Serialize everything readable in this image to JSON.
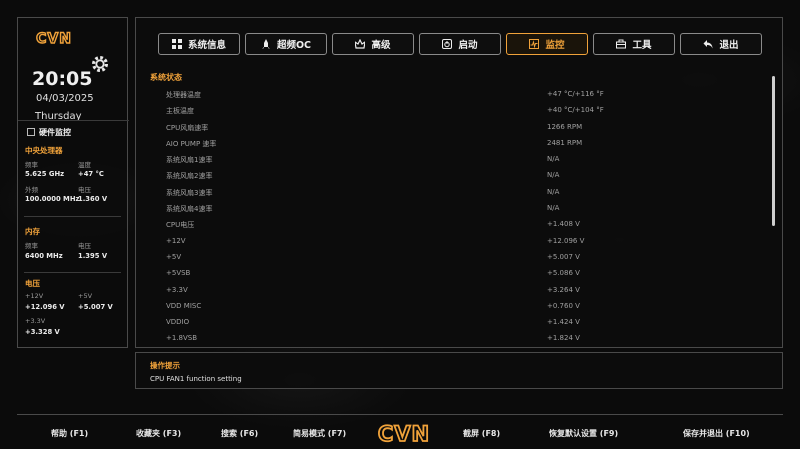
{
  "brand": {
    "logo_text": "CVN",
    "accent": "#f0a23a"
  },
  "clock": {
    "time": "20:05",
    "date": "04/03/2025",
    "day": "Thursday"
  },
  "hw_monitor": {
    "title": "硬件监控",
    "cpu": {
      "title": "中央处理器",
      "freq_label": "频率",
      "freq_value": "5.625 GHz",
      "temp_label": "温度",
      "temp_value": "+47 °C",
      "ext_label": "外频",
      "ext_value": "100.0000 MHz",
      "volt_label": "电压",
      "volt_value": "1.360 V"
    },
    "memory": {
      "title": "内存",
      "freq_label": "频率",
      "freq_value": "6400 MHz",
      "volt_label": "电压",
      "volt_value": "1.395 V"
    },
    "voltage": {
      "title": "电压",
      "v12_label": "+12V",
      "v12_value": "+12.096 V",
      "v5_label": "+5V",
      "v5_value": "+5.007 V",
      "v33_label": "+3.3V",
      "v33_value": "+3.328 V"
    }
  },
  "tabs": [
    {
      "label": "系统信息",
      "icon": "grid-icon"
    },
    {
      "label": "超频OC",
      "icon": "rocket-icon"
    },
    {
      "label": "高级",
      "icon": "crown-icon"
    },
    {
      "label": "启动",
      "icon": "power-icon"
    },
    {
      "label": "监控",
      "icon": "monitor-icon",
      "active": true
    },
    {
      "label": "工具",
      "icon": "toolbox-icon"
    },
    {
      "label": "退出",
      "icon": "back-arrow-icon"
    }
  ],
  "status": {
    "title": "系统状态",
    "rows": [
      {
        "name": "处理器温度",
        "value": "+47 °C/+116 °F"
      },
      {
        "name": "主板温度",
        "value": "+40 °C/+104 °F"
      },
      {
        "name": "CPU风扇速率",
        "value": "1266 RPM"
      },
      {
        "name": "AIO PUMP 速率",
        "value": "2481 RPM"
      },
      {
        "name": "系统风扇1速率",
        "value": "N/A"
      },
      {
        "name": "系统风扇2速率",
        "value": "N/A"
      },
      {
        "name": "系统风扇3速率",
        "value": "N/A"
      },
      {
        "name": "系统风扇4速率",
        "value": "N/A"
      },
      {
        "name": "CPU电压",
        "value": "+1.408 V"
      },
      {
        "name": "+12V",
        "value": "+12.096 V"
      },
      {
        "name": "+5V",
        "value": "+5.007 V"
      },
      {
        "name": "+5VSB",
        "value": "+5.086 V"
      },
      {
        "name": "+3.3V",
        "value": "+3.264 V"
      },
      {
        "name": "VDD MISC",
        "value": "+0.760 V"
      },
      {
        "name": "VDDIO",
        "value": "+1.424 V"
      },
      {
        "name": "+1.8VSB",
        "value": "+1.824 V"
      }
    ]
  },
  "help": {
    "title": "操作提示",
    "text": "CPU FAN1 function setting"
  },
  "footer": {
    "help": "帮助 (F1)",
    "favorites": "收藏夹 (F3)",
    "search": "搜索 (F6)",
    "easy_mode": "简易模式 (F7)",
    "screenshot": "截屏 (F8)",
    "restore_defaults": "恢复默认设置 (F9)",
    "save_exit": "保存并退出 (F10)"
  }
}
